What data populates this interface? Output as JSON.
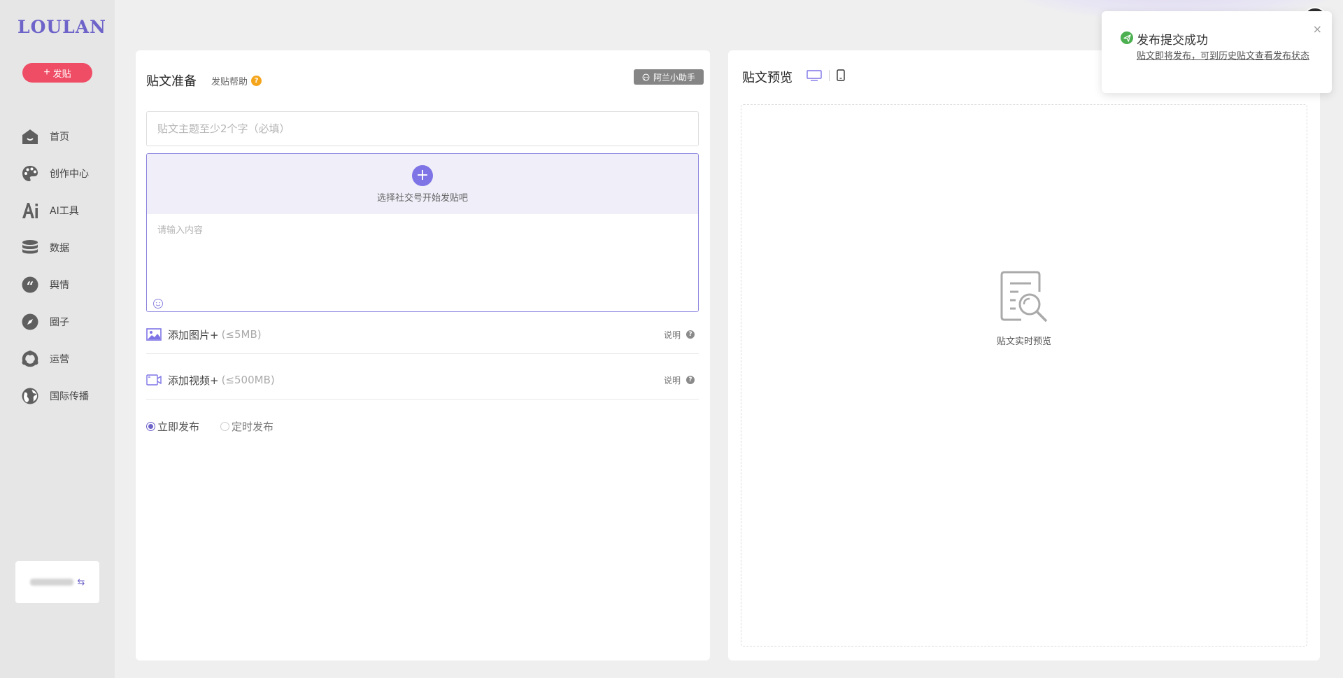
{
  "app": {
    "logo": "LOULAN"
  },
  "sidebar": {
    "post_button": "发贴",
    "items": [
      {
        "label": "首页",
        "icon": "home-icon"
      },
      {
        "label": "创作中心",
        "icon": "palette-icon"
      },
      {
        "label": "AI工具",
        "icon": "ai-icon"
      },
      {
        "label": "数据",
        "icon": "database-icon"
      },
      {
        "label": "舆情",
        "icon": "quote-icon"
      },
      {
        "label": "圈子",
        "icon": "compass-icon"
      },
      {
        "label": "运营",
        "icon": "operation-icon"
      },
      {
        "label": "国际传播",
        "icon": "globe-icon"
      }
    ]
  },
  "editor": {
    "title": "贴文准备",
    "help": "发贴帮助",
    "help_mark": "?",
    "assistant": "阿兰小助手",
    "title_placeholder": "贴文主题至少2个字（必填）",
    "select_account": "选择社交号开始发贴吧",
    "content_placeholder": "请输入内容",
    "add_image": "添加图片+",
    "image_limit": "(≤5MB)",
    "add_video": "添加视频+",
    "video_limit": "(≤500MB)",
    "note": "说明",
    "note_mark": "?",
    "publish_now": "立即发布",
    "publish_scheduled": "定时发布"
  },
  "preview": {
    "title": "贴文预览",
    "empty_text": "贴文实时预览"
  },
  "toast": {
    "title": "发布提交成功",
    "message": "贴文即将发布，可到历史贴文查看发布状态",
    "close": "×"
  },
  "colors": {
    "accent": "#6d63c9",
    "post_button": "#ef4c65",
    "success": "#4caf50"
  }
}
